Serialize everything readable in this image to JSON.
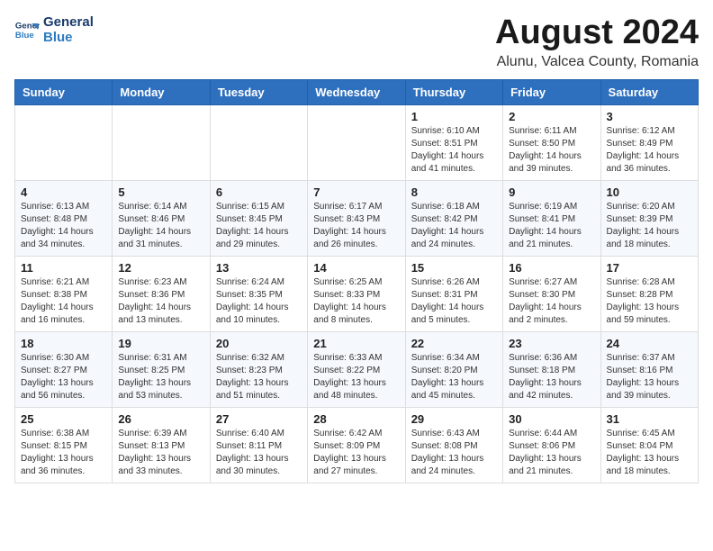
{
  "logo": {
    "line1": "General",
    "line2": "Blue"
  },
  "title": "August 2024",
  "location": "Alunu, Valcea County, Romania",
  "weekdays": [
    "Sunday",
    "Monday",
    "Tuesday",
    "Wednesday",
    "Thursday",
    "Friday",
    "Saturday"
  ],
  "weeks": [
    [
      {
        "day": "",
        "content": ""
      },
      {
        "day": "",
        "content": ""
      },
      {
        "day": "",
        "content": ""
      },
      {
        "day": "",
        "content": ""
      },
      {
        "day": "1",
        "content": "Sunrise: 6:10 AM\nSunset: 8:51 PM\nDaylight: 14 hours\nand 41 minutes."
      },
      {
        "day": "2",
        "content": "Sunrise: 6:11 AM\nSunset: 8:50 PM\nDaylight: 14 hours\nand 39 minutes."
      },
      {
        "day": "3",
        "content": "Sunrise: 6:12 AM\nSunset: 8:49 PM\nDaylight: 14 hours\nand 36 minutes."
      }
    ],
    [
      {
        "day": "4",
        "content": "Sunrise: 6:13 AM\nSunset: 8:48 PM\nDaylight: 14 hours\nand 34 minutes."
      },
      {
        "day": "5",
        "content": "Sunrise: 6:14 AM\nSunset: 8:46 PM\nDaylight: 14 hours\nand 31 minutes."
      },
      {
        "day": "6",
        "content": "Sunrise: 6:15 AM\nSunset: 8:45 PM\nDaylight: 14 hours\nand 29 minutes."
      },
      {
        "day": "7",
        "content": "Sunrise: 6:17 AM\nSunset: 8:43 PM\nDaylight: 14 hours\nand 26 minutes."
      },
      {
        "day": "8",
        "content": "Sunrise: 6:18 AM\nSunset: 8:42 PM\nDaylight: 14 hours\nand 24 minutes."
      },
      {
        "day": "9",
        "content": "Sunrise: 6:19 AM\nSunset: 8:41 PM\nDaylight: 14 hours\nand 21 minutes."
      },
      {
        "day": "10",
        "content": "Sunrise: 6:20 AM\nSunset: 8:39 PM\nDaylight: 14 hours\nand 18 minutes."
      }
    ],
    [
      {
        "day": "11",
        "content": "Sunrise: 6:21 AM\nSunset: 8:38 PM\nDaylight: 14 hours\nand 16 minutes."
      },
      {
        "day": "12",
        "content": "Sunrise: 6:23 AM\nSunset: 8:36 PM\nDaylight: 14 hours\nand 13 minutes."
      },
      {
        "day": "13",
        "content": "Sunrise: 6:24 AM\nSunset: 8:35 PM\nDaylight: 14 hours\nand 10 minutes."
      },
      {
        "day": "14",
        "content": "Sunrise: 6:25 AM\nSunset: 8:33 PM\nDaylight: 14 hours\nand 8 minutes."
      },
      {
        "day": "15",
        "content": "Sunrise: 6:26 AM\nSunset: 8:31 PM\nDaylight: 14 hours\nand 5 minutes."
      },
      {
        "day": "16",
        "content": "Sunrise: 6:27 AM\nSunset: 8:30 PM\nDaylight: 14 hours\nand 2 minutes."
      },
      {
        "day": "17",
        "content": "Sunrise: 6:28 AM\nSunset: 8:28 PM\nDaylight: 13 hours\nand 59 minutes."
      }
    ],
    [
      {
        "day": "18",
        "content": "Sunrise: 6:30 AM\nSunset: 8:27 PM\nDaylight: 13 hours\nand 56 minutes."
      },
      {
        "day": "19",
        "content": "Sunrise: 6:31 AM\nSunset: 8:25 PM\nDaylight: 13 hours\nand 53 minutes."
      },
      {
        "day": "20",
        "content": "Sunrise: 6:32 AM\nSunset: 8:23 PM\nDaylight: 13 hours\nand 51 minutes."
      },
      {
        "day": "21",
        "content": "Sunrise: 6:33 AM\nSunset: 8:22 PM\nDaylight: 13 hours\nand 48 minutes."
      },
      {
        "day": "22",
        "content": "Sunrise: 6:34 AM\nSunset: 8:20 PM\nDaylight: 13 hours\nand 45 minutes."
      },
      {
        "day": "23",
        "content": "Sunrise: 6:36 AM\nSunset: 8:18 PM\nDaylight: 13 hours\nand 42 minutes."
      },
      {
        "day": "24",
        "content": "Sunrise: 6:37 AM\nSunset: 8:16 PM\nDaylight: 13 hours\nand 39 minutes."
      }
    ],
    [
      {
        "day": "25",
        "content": "Sunrise: 6:38 AM\nSunset: 8:15 PM\nDaylight: 13 hours\nand 36 minutes."
      },
      {
        "day": "26",
        "content": "Sunrise: 6:39 AM\nSunset: 8:13 PM\nDaylight: 13 hours\nand 33 minutes."
      },
      {
        "day": "27",
        "content": "Sunrise: 6:40 AM\nSunset: 8:11 PM\nDaylight: 13 hours\nand 30 minutes."
      },
      {
        "day": "28",
        "content": "Sunrise: 6:42 AM\nSunset: 8:09 PM\nDaylight: 13 hours\nand 27 minutes."
      },
      {
        "day": "29",
        "content": "Sunrise: 6:43 AM\nSunset: 8:08 PM\nDaylight: 13 hours\nand 24 minutes."
      },
      {
        "day": "30",
        "content": "Sunrise: 6:44 AM\nSunset: 8:06 PM\nDaylight: 13 hours\nand 21 minutes."
      },
      {
        "day": "31",
        "content": "Sunrise: 6:45 AM\nSunset: 8:04 PM\nDaylight: 13 hours\nand 18 minutes."
      }
    ]
  ]
}
